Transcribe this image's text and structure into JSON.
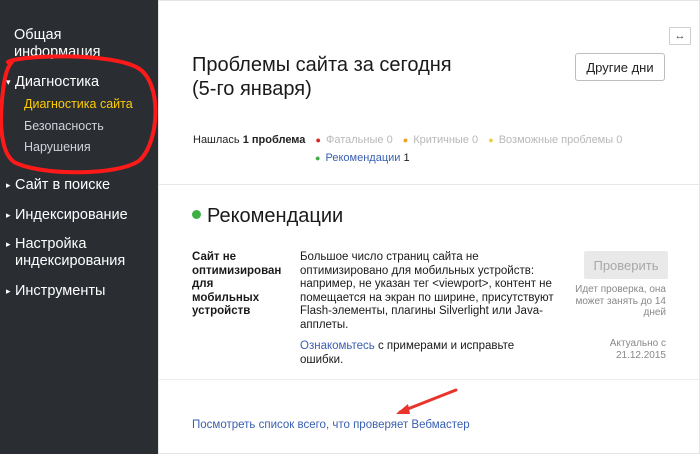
{
  "sidebar": {
    "items": [
      {
        "label": "Общая информация"
      },
      {
        "label": "Диагностика",
        "arrow": "▾"
      },
      {
        "label": "Сайт в поиске",
        "arrow": "▸"
      },
      {
        "label": "Индексирование",
        "arrow": "▸"
      },
      {
        "label": "Настройка индексирования",
        "arrow": "▸"
      },
      {
        "label": "Инструменты",
        "arrow": "▸"
      }
    ],
    "subitems": [
      {
        "label": "Диагностика сайта",
        "active": true
      },
      {
        "label": "Безопасность"
      },
      {
        "label": "Нарушения"
      }
    ]
  },
  "header": {
    "title_line1": "Проблемы сайта за сегодня",
    "title_line2": "(5-го января)",
    "other_days_label": "Другие дни",
    "expand_icon": "↔"
  },
  "summary": {
    "found_prefix": "Нашлась",
    "found_count": "1 проблема",
    "legend": [
      {
        "label": "Фатальные",
        "count": "0",
        "color": "#e02020"
      },
      {
        "label": "Критичные",
        "count": "0",
        "color": "#f0a020"
      },
      {
        "label": "Возможные проблемы",
        "count": "0",
        "color": "#f0d040"
      },
      {
        "label": "Рекомендации",
        "count": "1",
        "color": "#3cb043"
      }
    ]
  },
  "section": {
    "title": "Рекомендации"
  },
  "issue": {
    "name": "Сайт не оптимизирован для мобильных устройств",
    "description": "Большое число страниц сайта не оптимизировано для мобильных устройств: например, не указан тег <viewport>, контент не помещается на экран по ширине, присутствуют Flash-элементы, плагины Silverlight или Java-апплеты.",
    "more_link": "Ознакомьтесь",
    "more_text": " с примерами и исправьте ошибки.",
    "check_button": "Проверить",
    "check_note": "Идет проверка, она может занять до 14 дней",
    "actual_note": "Актуально с 21.12.2015"
  },
  "footer": {
    "link": "Посмотреть список всего, что проверяет Вебмастер"
  }
}
